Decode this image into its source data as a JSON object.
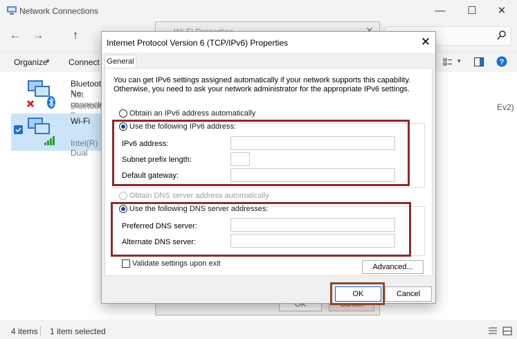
{
  "window": {
    "title": "Network Connections",
    "minimize": "—",
    "maximize": "☐",
    "close": "✕"
  },
  "nav": {
    "back": "←",
    "forward": "→",
    "up": "↑"
  },
  "commandbar": {
    "organize": "Organize",
    "connect_to": "Connect T",
    "chevron": "▾"
  },
  "connections": [
    {
      "name": "Bluetooth Ne",
      "status": "Not connecte",
      "device": "Bluetooth De"
    },
    {
      "name": "Wi-Fi",
      "status": "",
      "device": "Intel(R) Dual"
    }
  ],
  "background_text": {
    "right_label": "Ev2)"
  },
  "statusbar": {
    "items": "4 items",
    "selected": "1 item selected"
  },
  "wifi_dialog": {
    "title": "Wi-Fi Properties",
    "close": "✕",
    "ok": "OK",
    "cancel": "Cancel"
  },
  "dialog": {
    "title": "Internet Protocol Version 6 (TCP/IPv6) Properties",
    "close": "✕",
    "tab": "General",
    "info_line1": "You can get IPv6 settings assigned automatically if your network supports this capability.",
    "info_line2": "Otherwise, you need to ask your network administrator for the appropriate IPv6 settings.",
    "ip_auto": "Obtain an IPv6 address automatically",
    "ip_manual": "Use the following IPv6 address:",
    "ipv6_address_label": "IPv6 address:",
    "subnet_label": "Subnet prefix length:",
    "gateway_label": "Default gateway:",
    "ipv6_address_value": "",
    "subnet_value": "",
    "gateway_value": "",
    "dns_auto": "Obtain DNS server address automatically",
    "dns_manual": "Use the following DNS server addresses:",
    "preferred_dns_label": "Preferred DNS server:",
    "alternate_dns_label": "Alternate DNS server:",
    "preferred_dns_value": "",
    "alternate_dns_value": "",
    "validate": "Validate settings upon exit",
    "advanced": "Advanced...",
    "ok": "OK",
    "cancel": "Cancel"
  },
  "colors": {
    "highlight": "#8b2b2b",
    "selection": "#cce4f7",
    "radio_fill": "#1a3aa8"
  }
}
